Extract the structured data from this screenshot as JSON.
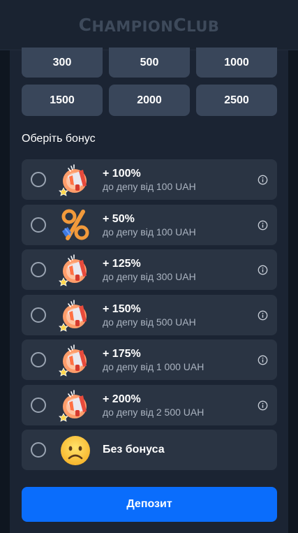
{
  "header": {
    "logo_text": "ChampionClub",
    "logo_part1_big": "C",
    "logo_part1": "HAMPION",
    "logo_part2_big": "C",
    "logo_part2": "LUB"
  },
  "amounts": [
    "300",
    "500",
    "1000",
    "1500",
    "2000",
    "2500"
  ],
  "bonus_section": {
    "title": "Оберіть бонус",
    "items": [
      {
        "percent": "+ 100%",
        "condition": "до депу від 100 UAH",
        "icon": "megaphone-icon"
      },
      {
        "percent": "+ 50%",
        "condition": "до депу від 100 UAH",
        "icon": "percent-icon"
      },
      {
        "percent": "+ 125%",
        "condition": "до депу від 300 UAH",
        "icon": "megaphone-icon"
      },
      {
        "percent": "+ 150%",
        "condition": "до депу від 500 UAH",
        "icon": "megaphone-icon"
      },
      {
        "percent": "+ 175%",
        "condition": "до депу від 1 000 UAH",
        "icon": "megaphone-icon"
      },
      {
        "percent": "+ 200%",
        "condition": "до депу від 2 500 UAH",
        "icon": "megaphone-icon"
      }
    ],
    "no_bonus": {
      "label": "Без бонуса",
      "icon": "sad-face-icon"
    }
  },
  "deposit_button": {
    "label": "Депозит"
  },
  "colors": {
    "accent": "#0a6dfc",
    "panel": "#1b2433",
    "card": "#2a3443",
    "amount_button": "#39465a"
  }
}
